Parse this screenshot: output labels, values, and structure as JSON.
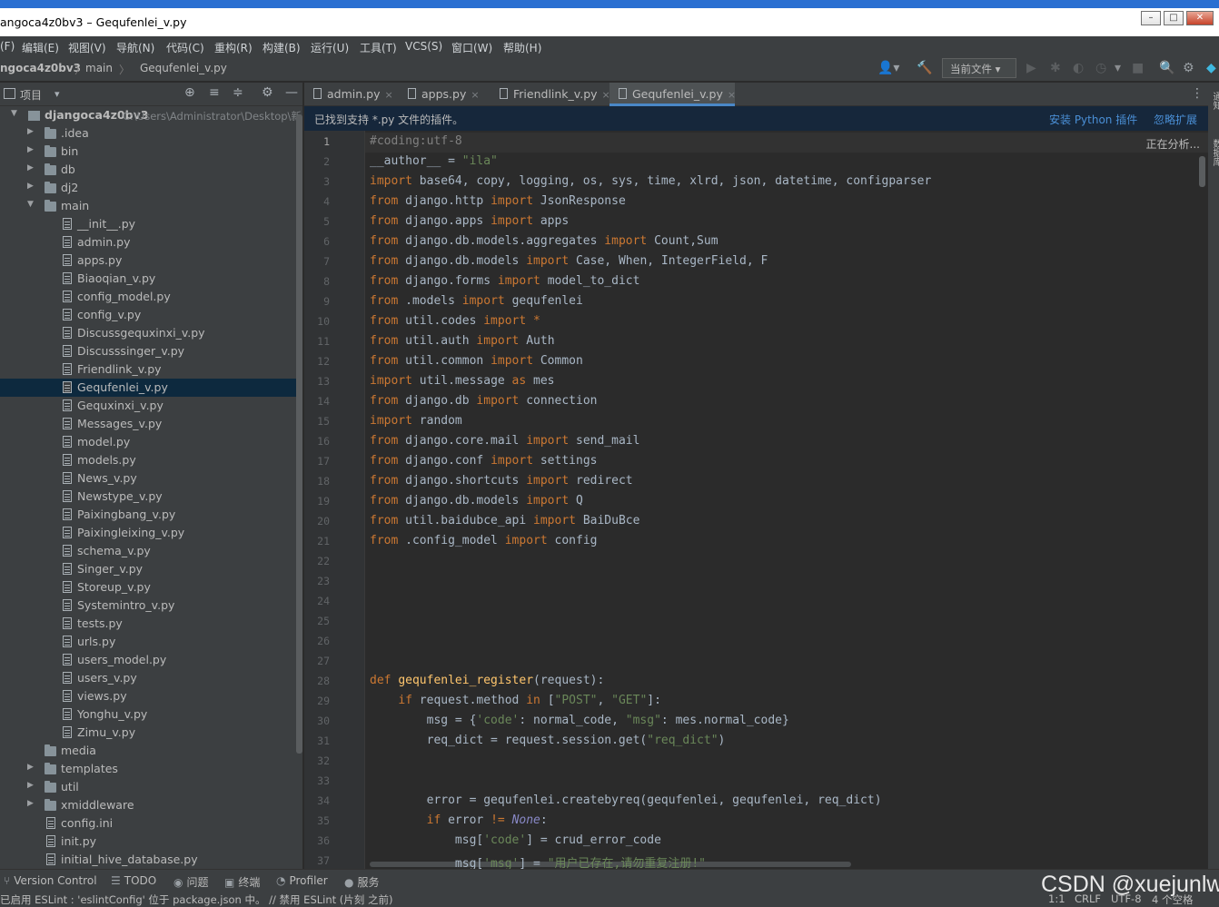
{
  "window": {
    "title": "angoca4z0bv3 – Gequfenlei_v.py",
    "min": "–",
    "max": "□",
    "close": "✕"
  },
  "menu": [
    "(F)",
    "编辑(E)",
    "视图(V)",
    "导航(N)",
    "代码(C)",
    "重构(R)",
    "构建(B)",
    "运行(U)",
    "工具(T)",
    "VCS(S)",
    "窗口(W)",
    "帮助(H)"
  ],
  "breadcrumb": {
    "project": "ngoca4z0bv3",
    "sep": "〉",
    "folder": "main",
    "file": "Gequfenlei_v.py"
  },
  "toolbar": {
    "run_config": "当前文件 ▾",
    "user_icon": "👤▾",
    "build_icon": "🔨",
    "run_icon": "▶",
    "debug_icon": "✱",
    "coverage_icon": "◐",
    "profile_icon": "◷",
    "more_icon": "▾",
    "stop_icon": "■",
    "search_icon": "🔍",
    "settings_icon": "⚙",
    "plugin_icon": "◆"
  },
  "project_panel": {
    "label": "项目",
    "dropdown": "▾",
    "locate_icon": "⊕",
    "expand_icon": "≡",
    "collapse_icon": "≑",
    "gear_icon": "⚙",
    "hide_icon": "—"
  },
  "tree": [
    {
      "depth": 0,
      "type": "module",
      "name": "djangoca4z0bv3",
      "path": "C:\\Users\\Administrator\\Desktop\\新",
      "arrow": "down",
      "bold": true
    },
    {
      "depth": 1,
      "type": "folder",
      "name": ".idea",
      "arrow": "right"
    },
    {
      "depth": 1,
      "type": "folder",
      "name": "bin",
      "arrow": "right"
    },
    {
      "depth": 1,
      "type": "folder",
      "name": "db",
      "arrow": "right"
    },
    {
      "depth": 1,
      "type": "folder",
      "name": "dj2",
      "arrow": "right"
    },
    {
      "depth": 1,
      "type": "folder",
      "name": "main",
      "arrow": "down"
    },
    {
      "depth": 2,
      "type": "file",
      "name": "__init__.py"
    },
    {
      "depth": 2,
      "type": "file",
      "name": "admin.py"
    },
    {
      "depth": 2,
      "type": "file",
      "name": "apps.py"
    },
    {
      "depth": 2,
      "type": "file",
      "name": "Biaoqian_v.py"
    },
    {
      "depth": 2,
      "type": "file",
      "name": "config_model.py"
    },
    {
      "depth": 2,
      "type": "file",
      "name": "config_v.py"
    },
    {
      "depth": 2,
      "type": "file",
      "name": "Discussgequxinxi_v.py"
    },
    {
      "depth": 2,
      "type": "file",
      "name": "Discusssinger_v.py"
    },
    {
      "depth": 2,
      "type": "file",
      "name": "Friendlink_v.py"
    },
    {
      "depth": 2,
      "type": "file",
      "name": "Gequfenlei_v.py",
      "selected": true
    },
    {
      "depth": 2,
      "type": "file",
      "name": "Gequxinxi_v.py"
    },
    {
      "depth": 2,
      "type": "file",
      "name": "Messages_v.py"
    },
    {
      "depth": 2,
      "type": "file",
      "name": "model.py"
    },
    {
      "depth": 2,
      "type": "file",
      "name": "models.py"
    },
    {
      "depth": 2,
      "type": "file",
      "name": "News_v.py"
    },
    {
      "depth": 2,
      "type": "file",
      "name": "Newstype_v.py"
    },
    {
      "depth": 2,
      "type": "file",
      "name": "Paixingbang_v.py"
    },
    {
      "depth": 2,
      "type": "file",
      "name": "Paixingleixing_v.py"
    },
    {
      "depth": 2,
      "type": "file",
      "name": "schema_v.py"
    },
    {
      "depth": 2,
      "type": "file",
      "name": "Singer_v.py"
    },
    {
      "depth": 2,
      "type": "file",
      "name": "Storeup_v.py"
    },
    {
      "depth": 2,
      "type": "file",
      "name": "Systemintro_v.py"
    },
    {
      "depth": 2,
      "type": "file",
      "name": "tests.py"
    },
    {
      "depth": 2,
      "type": "file",
      "name": "urls.py"
    },
    {
      "depth": 2,
      "type": "file",
      "name": "users_model.py"
    },
    {
      "depth": 2,
      "type": "file",
      "name": "users_v.py"
    },
    {
      "depth": 2,
      "type": "file",
      "name": "views.py"
    },
    {
      "depth": 2,
      "type": "file",
      "name": "Yonghu_v.py"
    },
    {
      "depth": 2,
      "type": "file",
      "name": "Zimu_v.py"
    },
    {
      "depth": 1,
      "type": "folder",
      "name": "media"
    },
    {
      "depth": 1,
      "type": "folder",
      "name": "templates",
      "arrow": "right"
    },
    {
      "depth": 1,
      "type": "folder",
      "name": "util",
      "arrow": "right"
    },
    {
      "depth": 1,
      "type": "folder",
      "name": "xmiddleware",
      "arrow": "right"
    },
    {
      "depth": 1,
      "type": "file",
      "name": "config.ini"
    },
    {
      "depth": 1,
      "type": "file",
      "name": "init.py"
    },
    {
      "depth": 1,
      "type": "file",
      "name": "initial_hive_database.py"
    }
  ],
  "tabs": [
    {
      "name": "admin.py",
      "close": "×"
    },
    {
      "name": "apps.py",
      "close": "×"
    },
    {
      "name": "Friendlink_v.py",
      "close": "×"
    },
    {
      "name": "Gequfenlei_v.py",
      "close": "×",
      "active": true
    }
  ],
  "tab_menu_icon": "⋮",
  "banner": {
    "message": "已找到支持 *.py 文件的插件。",
    "install": "安装 Python 插件",
    "ignore": "忽略扩展"
  },
  "editor": {
    "analyzing": "正在分析...",
    "current_line": 1,
    "lines": [
      [
        [
          "cm",
          "#coding:utf-8"
        ]
      ],
      [
        [
          "",
          "__author__ = "
        ],
        [
          "str",
          "\"ila\""
        ]
      ],
      [
        [
          "kw",
          "import "
        ],
        [
          "",
          "base64, copy, logging, os, sys, time, xlrd, json, datetime, configparser"
        ]
      ],
      [
        [
          "kw",
          "from "
        ],
        [
          "",
          "django.http "
        ],
        [
          "kw",
          "import "
        ],
        [
          "",
          "JsonResponse"
        ]
      ],
      [
        [
          "kw",
          "from "
        ],
        [
          "",
          "django.apps "
        ],
        [
          "kw",
          "import "
        ],
        [
          "",
          "apps"
        ]
      ],
      [
        [
          "kw",
          "from "
        ],
        [
          "",
          "django.db.models.aggregates "
        ],
        [
          "kw",
          "import "
        ],
        [
          "",
          "Count,Sum"
        ]
      ],
      [
        [
          "kw",
          "from "
        ],
        [
          "",
          "django.db.models "
        ],
        [
          "kw",
          "import "
        ],
        [
          "",
          "Case, When, IntegerField, F"
        ]
      ],
      [
        [
          "kw",
          "from "
        ],
        [
          "",
          "django.forms "
        ],
        [
          "kw",
          "import "
        ],
        [
          "",
          "model_to_dict"
        ]
      ],
      [
        [
          "kw",
          "from "
        ],
        [
          "",
          ".models "
        ],
        [
          "kw",
          "import "
        ],
        [
          "",
          "gequfenlei"
        ]
      ],
      [
        [
          "kw",
          "from "
        ],
        [
          "",
          "util.codes "
        ],
        [
          "kw",
          "import "
        ],
        [
          "kw",
          "*"
        ]
      ],
      [
        [
          "kw",
          "from "
        ],
        [
          "",
          "util.auth "
        ],
        [
          "kw",
          "import "
        ],
        [
          "",
          "Auth"
        ]
      ],
      [
        [
          "kw",
          "from "
        ],
        [
          "",
          "util.common "
        ],
        [
          "kw",
          "import "
        ],
        [
          "",
          "Common"
        ]
      ],
      [
        [
          "kw",
          "import "
        ],
        [
          "",
          "util.message "
        ],
        [
          "kw",
          "as "
        ],
        [
          "",
          "mes"
        ]
      ],
      [
        [
          "kw",
          "from "
        ],
        [
          "",
          "django.db "
        ],
        [
          "kw",
          "import "
        ],
        [
          "",
          "connection"
        ]
      ],
      [
        [
          "kw",
          "import "
        ],
        [
          "",
          "random"
        ]
      ],
      [
        [
          "kw",
          "from "
        ],
        [
          "",
          "django.core.mail "
        ],
        [
          "kw",
          "import "
        ],
        [
          "",
          "send_mail"
        ]
      ],
      [
        [
          "kw",
          "from "
        ],
        [
          "",
          "django.conf "
        ],
        [
          "kw",
          "import "
        ],
        [
          "",
          "settings"
        ]
      ],
      [
        [
          "kw",
          "from "
        ],
        [
          "",
          "django.shortcuts "
        ],
        [
          "kw",
          "import "
        ],
        [
          "",
          "redirect"
        ]
      ],
      [
        [
          "kw",
          "from "
        ],
        [
          "",
          "django.db.models "
        ],
        [
          "kw",
          "import "
        ],
        [
          "",
          "Q"
        ]
      ],
      [
        [
          "kw",
          "from "
        ],
        [
          "",
          "util.baidubce_api "
        ],
        [
          "kw",
          "import "
        ],
        [
          "",
          "BaiDuBce"
        ]
      ],
      [
        [
          "kw",
          "from "
        ],
        [
          "",
          ".config_model "
        ],
        [
          "kw",
          "import "
        ],
        [
          "",
          "config"
        ]
      ],
      [],
      [],
      [],
      [],
      [],
      [],
      [
        [
          "kw",
          "def "
        ],
        [
          "fn",
          "gequfenlei_register"
        ],
        [
          "",
          "(request):"
        ]
      ],
      [
        [
          "",
          "    "
        ],
        [
          "kw",
          "if "
        ],
        [
          "",
          "request.method "
        ],
        [
          "kw",
          "in "
        ],
        [
          "",
          "["
        ],
        [
          "str",
          "\"POST\""
        ],
        [
          "",
          ", "
        ],
        [
          "str",
          "\"GET\""
        ],
        [
          "",
          "]:"
        ]
      ],
      [
        [
          "",
          "        msg = {"
        ],
        [
          "str",
          "'code'"
        ],
        [
          "",
          ": normal_code, "
        ],
        [
          "str",
          "\"msg\""
        ],
        [
          "",
          ": mes.normal_code}"
        ]
      ],
      [
        [
          "",
          "        req_dict = request.session.get("
        ],
        [
          "str",
          "\"req_dict\""
        ],
        [
          "",
          ")"
        ]
      ],
      [],
      [],
      [
        [
          "",
          "        error = gequfenlei.createbyreq(gequfenlei, gequfenlei, req_dict)"
        ]
      ],
      [
        [
          "",
          "        "
        ],
        [
          "kw",
          "if "
        ],
        [
          "",
          "error "
        ],
        [
          "kw",
          "!= "
        ],
        [
          "it",
          "None"
        ],
        [
          "",
          ":"
        ]
      ],
      [
        [
          "",
          "            msg["
        ],
        [
          "str",
          "'code'"
        ],
        [
          "",
          "] = crud_error_code"
        ]
      ],
      [
        [
          "",
          "            msg["
        ],
        [
          "str",
          "'msg'"
        ],
        [
          "",
          "] = "
        ],
        [
          "str",
          "\"用户已存在,请勿重复注册!\""
        ]
      ]
    ]
  },
  "right_strip": [
    "通知",
    "数据库"
  ],
  "tool_windows": [
    {
      "icon": "⑂",
      "label": "Version Control"
    },
    {
      "icon": "☰",
      "label": "TODO"
    },
    {
      "icon": "◉",
      "label": "问题"
    },
    {
      "icon": "▣",
      "label": "终端"
    },
    {
      "icon": "◔",
      "label": "Profiler"
    },
    {
      "icon": "●",
      "label": "服务"
    }
  ],
  "status": {
    "message": "已启用 ESLint : 'eslintConfig' 位于 package.json 中。 // 禁用 ESLint (片刻 之前)",
    "position": "1:1",
    "line_sep": "CRLF",
    "encoding": "UTF-8",
    "indent": "4 个空格"
  },
  "watermark": "CSDN @xuejunlw"
}
